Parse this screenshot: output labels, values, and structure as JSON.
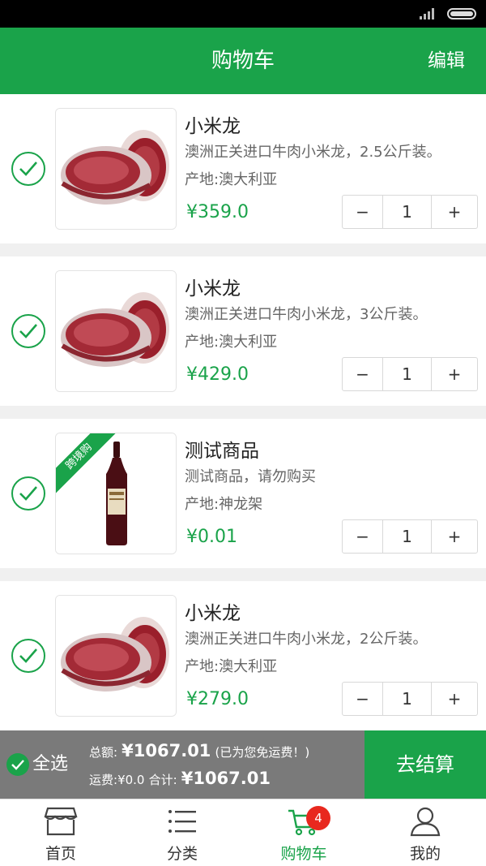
{
  "header": {
    "title": "购物车",
    "edit_label": "编辑"
  },
  "cart": {
    "items": [
      {
        "name": "小米龙",
        "description": "澳洲正关进口牛肉小米龙，2.5公斤装。",
        "origin": "产地:澳大利亚",
        "price": "¥359.0",
        "quantity": "1",
        "minus": "−",
        "plus": "+",
        "selected": true,
        "image": "beef"
      },
      {
        "name": "小米龙",
        "description": "澳洲正关进口牛肉小米龙，3公斤装。",
        "origin": "产地:澳大利亚",
        "price": "¥429.0",
        "quantity": "1",
        "minus": "−",
        "plus": "+",
        "selected": true,
        "image": "beef"
      },
      {
        "name": "测试商品",
        "description": "测试商品，请勿购买",
        "origin": "产地:神龙架",
        "price": "¥0.01",
        "quantity": "1",
        "minus": "−",
        "plus": "+",
        "selected": true,
        "image": "wine",
        "tag": "跨境购"
      },
      {
        "name": "小米龙",
        "description": "澳洲正关进口牛肉小米龙，2公斤装。",
        "origin": "产地:澳大利亚",
        "price": "¥279.0",
        "quantity": "1",
        "minus": "−",
        "plus": "+",
        "selected": true,
        "image": "beef"
      }
    ]
  },
  "checkout": {
    "select_all_label": "全选",
    "total_label": "总额:",
    "total_value": "¥1067.01",
    "free_shipping_note": "(已为您免运费！)",
    "shipping_label": "运费:",
    "shipping_value": "¥0.0",
    "sum_label": "合计:",
    "sum_value": "¥1067.01",
    "button_label": "去结算"
  },
  "tabs": [
    {
      "label": "首页",
      "icon": "store-icon"
    },
    {
      "label": "分类",
      "icon": "list-icon"
    },
    {
      "label": "购物车",
      "icon": "cart-icon",
      "badge": "4",
      "active": true
    },
    {
      "label": "我的",
      "icon": "user-icon"
    }
  ],
  "colors": {
    "accent": "#1aa34a",
    "badge": "#e8281e",
    "checkout_bar": "#7a7a7a"
  }
}
